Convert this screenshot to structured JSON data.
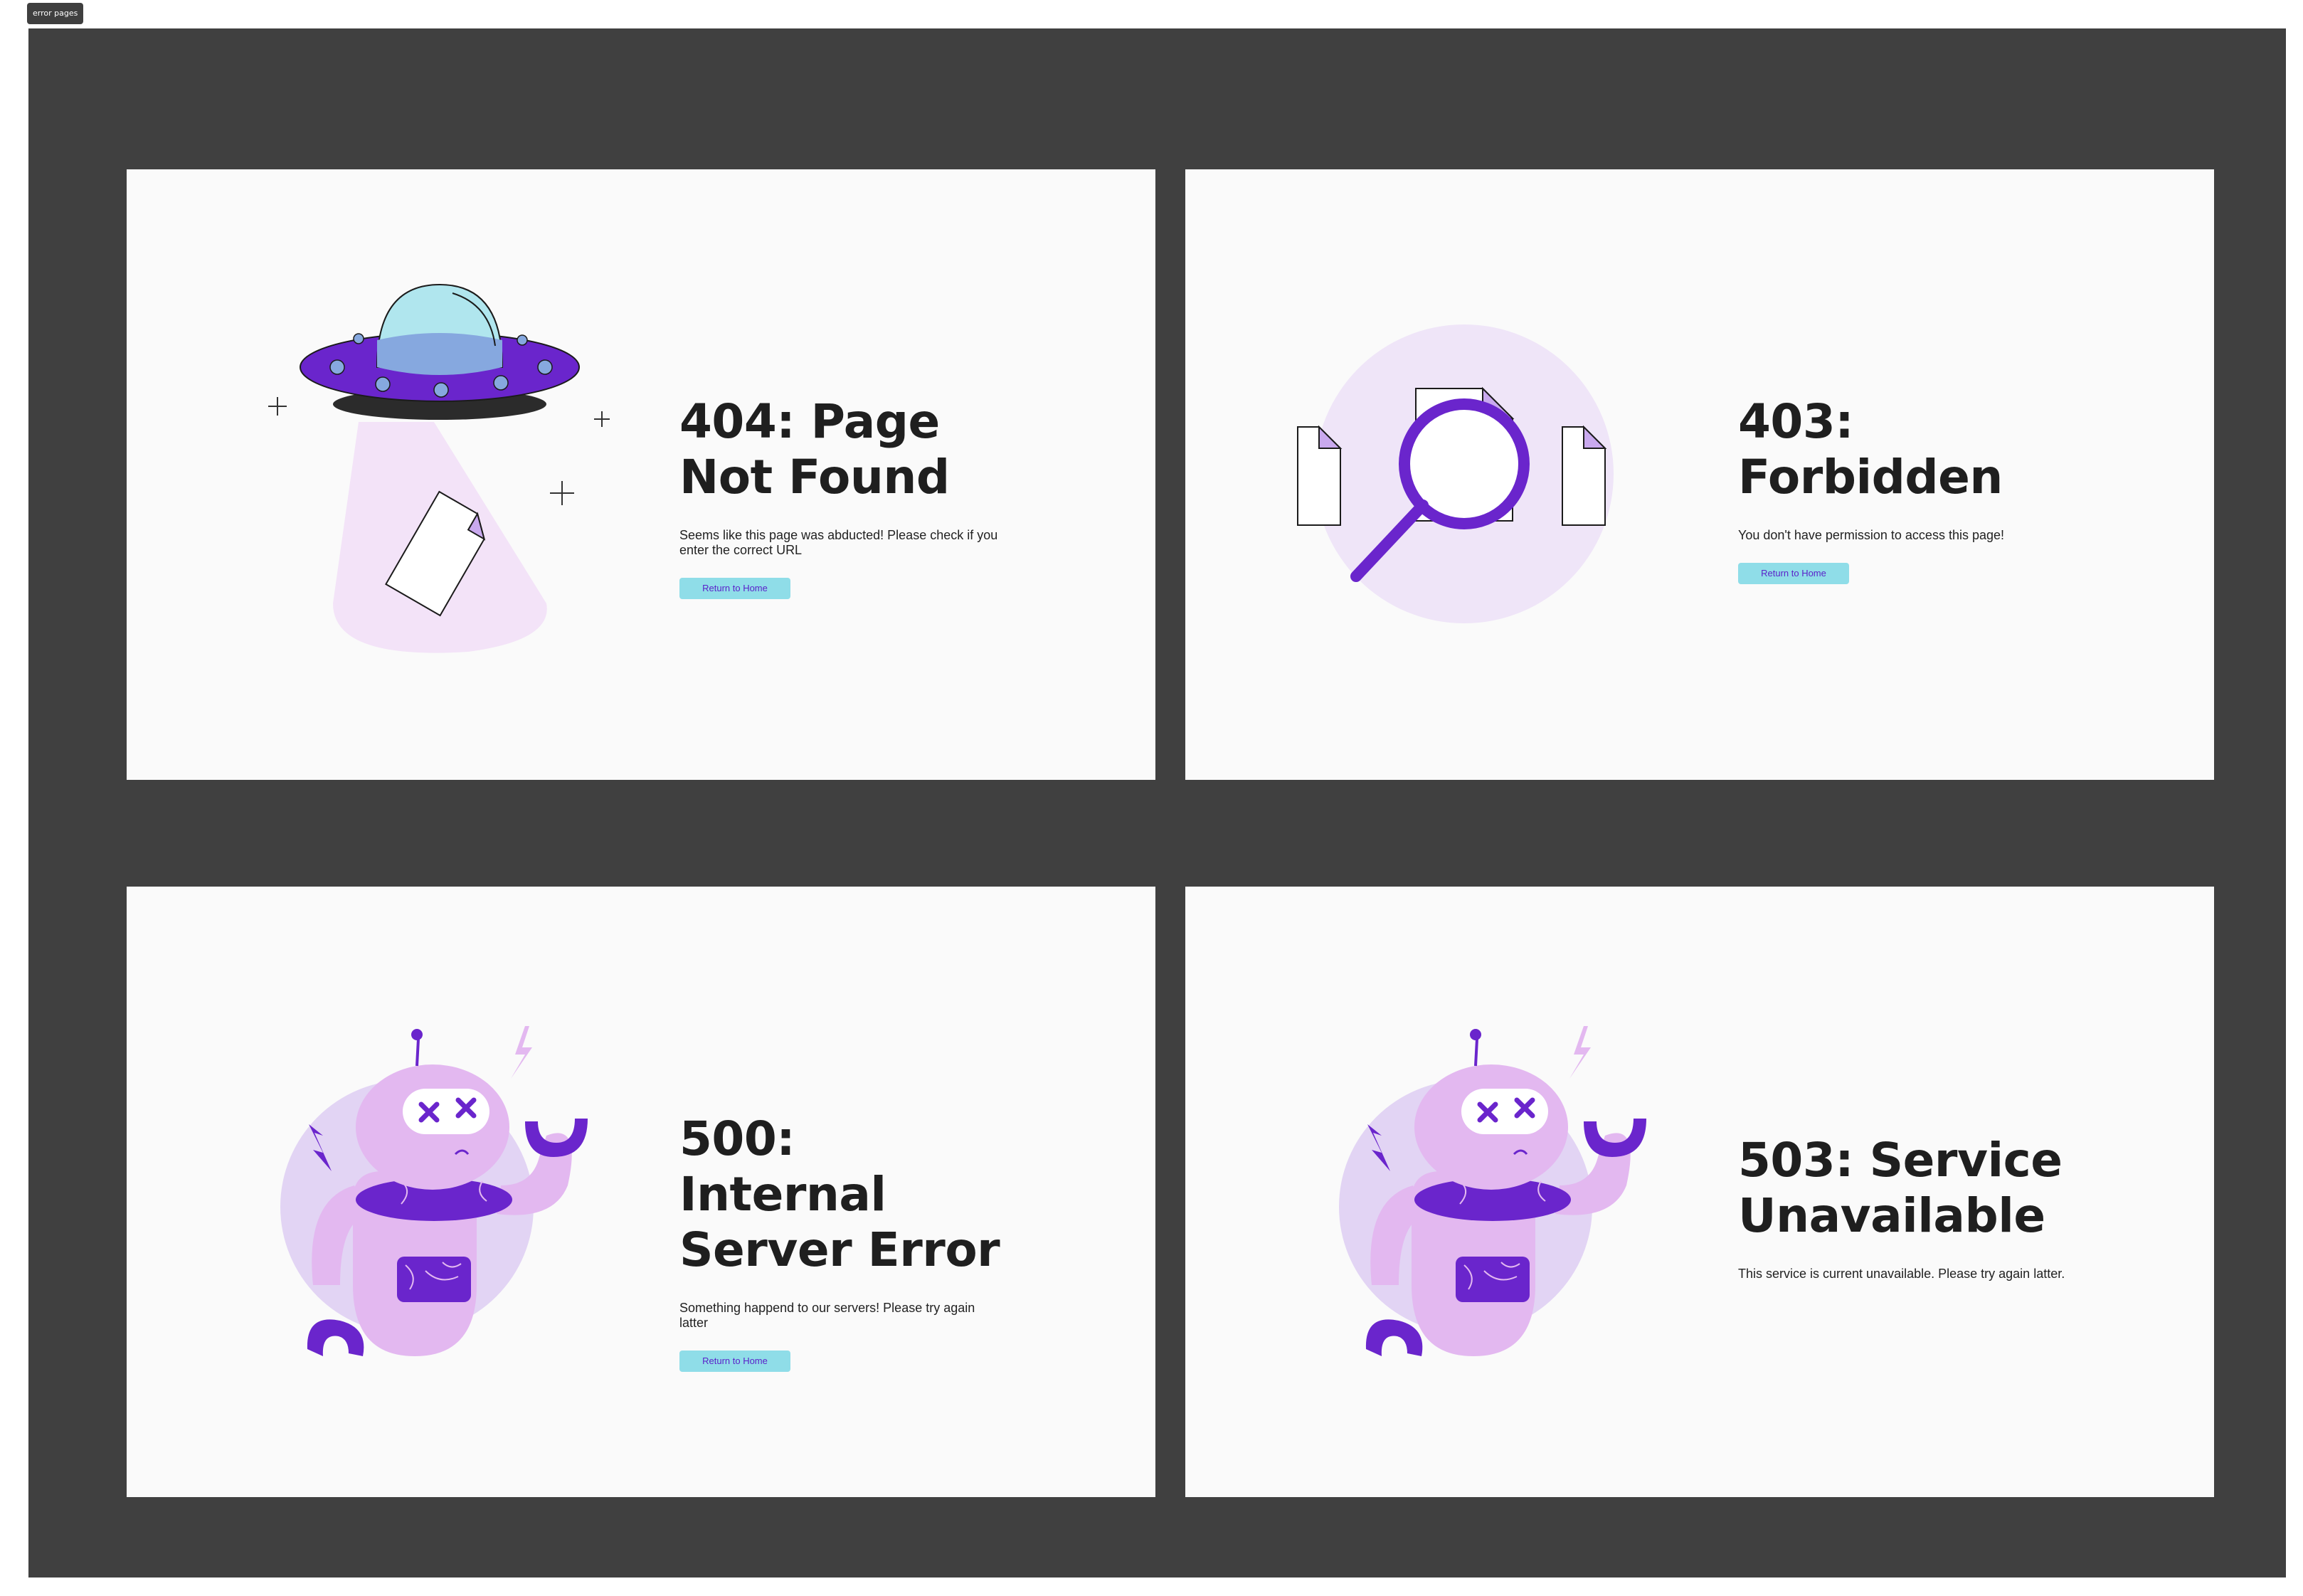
{
  "frame": {
    "label": "error pages"
  },
  "colors": {
    "canvas": "#404040",
    "card": "#fafafa",
    "accent": "#6a25cc",
    "lavender": "#e3b8f0",
    "button": "#8fdde8",
    "button_text": "#5a1fc9"
  },
  "cards": [
    {
      "title": "404: Page Not Found",
      "description": "Seems like this page was abducted! Please check if you enter the correct URL",
      "button": "Return to Home",
      "icon": "ufo-icon"
    },
    {
      "title": "403: Forbidden",
      "description": "You don't have permission to access this page!",
      "button": "Return to Home",
      "icon": "magnifier-documents-icon"
    },
    {
      "title": "500: Internal Server Error",
      "description": "Something happend to our servers! Please try again latter",
      "button": "Return to Home",
      "icon": "broken-robot-icon"
    },
    {
      "title": "503: Service Unavailable",
      "description": "This service is current unavailable. Please try again latter.",
      "icon": "broken-robot-icon"
    }
  ]
}
